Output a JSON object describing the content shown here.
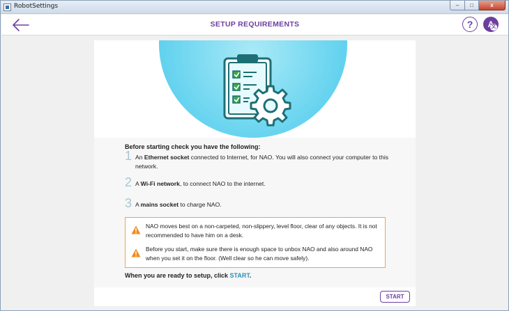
{
  "window": {
    "title": "RobotSettings",
    "minimize_label": "–",
    "maximize_label": "□",
    "close_label": "x"
  },
  "appbar": {
    "title": "SETUP REQUIREMENTS",
    "help_label": "?",
    "language_label": "A",
    "language_sub": "文"
  },
  "main": {
    "heading": "Before starting check you have the following:",
    "requirements": [
      {
        "number": "1",
        "prefix": "An ",
        "bold": "Ethernet socket",
        "suffix": " connected to Internet, for NAO. You will also connect your computer to this network."
      },
      {
        "number": "2",
        "prefix": "A ",
        "bold": "Wi-Fi network",
        "suffix": ", to connect NAO to the internet."
      },
      {
        "number": "3",
        "prefix": "A ",
        "bold": "mains socket",
        "suffix": " to charge NAO."
      }
    ],
    "warnings": [
      "NAO moves best on a non-carpeted, non-slippery, level floor, clear of any objects. It is not recommended to have him on a desk.",
      "Before you start, make sure there is enough space to unbox NAO and also around NAO when you set it on the floor. (Well clear so he can move safely)."
    ],
    "ready_prefix": "When you are ready to setup, click ",
    "ready_accent": "START",
    "ready_suffix": "."
  },
  "footer": {
    "start_label": "START"
  },
  "colors": {
    "brand": "#6b3fa0",
    "accent": "#2a8fb8",
    "warning": "#f0a34a",
    "hero": "#5dd0ee"
  }
}
